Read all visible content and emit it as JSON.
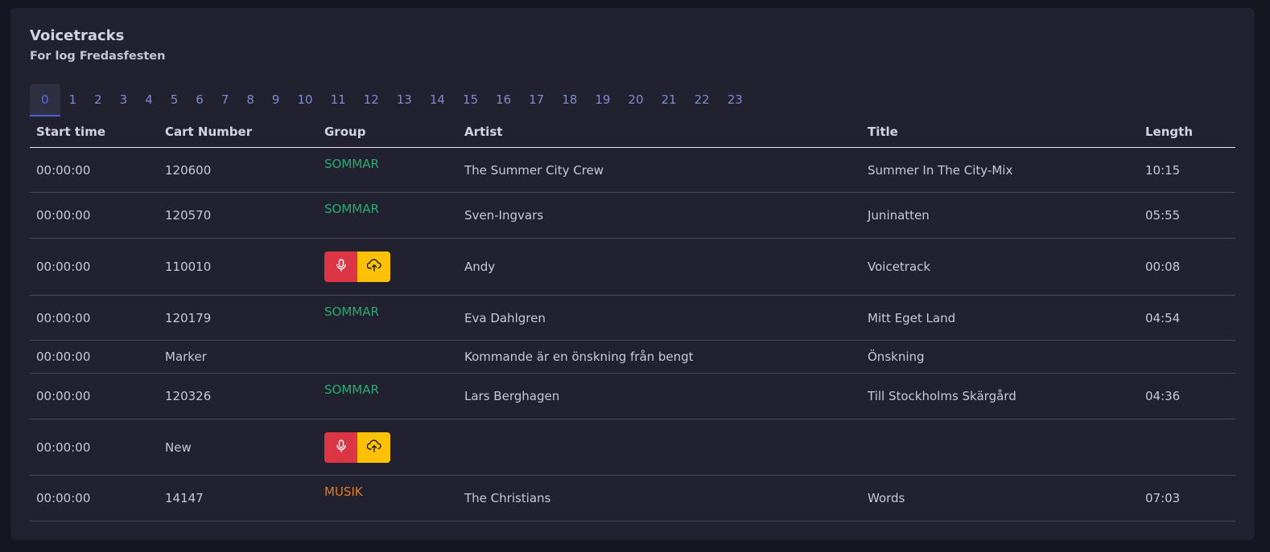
{
  "header": {
    "title": "Voicetracks",
    "subtitle": "For log Fredasfesten"
  },
  "tabs": [
    "0",
    "1",
    "2",
    "3",
    "4",
    "5",
    "6",
    "7",
    "8",
    "9",
    "10",
    "11",
    "12",
    "13",
    "14",
    "15",
    "16",
    "17",
    "18",
    "19",
    "20",
    "21",
    "22",
    "23"
  ],
  "active_tab": "0",
  "table": {
    "columns": [
      "Start time",
      "Cart Number",
      "Group",
      "Artist",
      "Title",
      "Length"
    ],
    "rows": [
      {
        "start": "00:00:00",
        "cart": "120600",
        "group": "SOMMAR",
        "group_color": "green",
        "artist": "The Summer City Crew",
        "title": "Summer In The City-Mix",
        "length": "10:15",
        "type": "track"
      },
      {
        "start": "00:00:00",
        "cart": "120570",
        "group": "SOMMAR",
        "group_color": "green",
        "artist": "Sven-Ingvars",
        "title": "Juninatten",
        "length": "05:55",
        "type": "track"
      },
      {
        "start": "00:00:00",
        "cart": "110010",
        "group": "",
        "artist": "Andy",
        "title": "Voicetrack",
        "length": "00:08",
        "type": "voicetrack"
      },
      {
        "start": "00:00:00",
        "cart": "120179",
        "group": "SOMMAR",
        "group_color": "green",
        "artist": "Eva Dahlgren",
        "title": "Mitt Eget Land",
        "length": "04:54",
        "type": "track"
      },
      {
        "start": "00:00:00",
        "cart": "Marker",
        "group": "",
        "artist": "Kommande är en önskning från bengt",
        "title": "Önskning",
        "length": "",
        "type": "marker"
      },
      {
        "start": "00:00:00",
        "cart": "120326",
        "group": "SOMMAR",
        "group_color": "green",
        "artist": "Lars Berghagen",
        "title": "Till Stockholms Skärgård",
        "length": "04:36",
        "type": "track"
      },
      {
        "start": "00:00:00",
        "cart": "New",
        "group": "",
        "artist": "",
        "title": "",
        "length": "",
        "type": "voicetrack"
      },
      {
        "start": "00:00:00",
        "cart": "14147",
        "group": "MUSIK",
        "group_color": "orange",
        "artist": "The Christians",
        "title": "Words",
        "length": "07:03",
        "type": "track"
      }
    ]
  },
  "colors": {
    "green": "#2aa972",
    "orange": "#e07b2a",
    "record_button": "#dc3545",
    "upload_button": "#ffc107",
    "tab_active": "#4b5fd6"
  },
  "icons": {
    "record": "microphone-icon",
    "upload": "cloud-upload-icon"
  }
}
